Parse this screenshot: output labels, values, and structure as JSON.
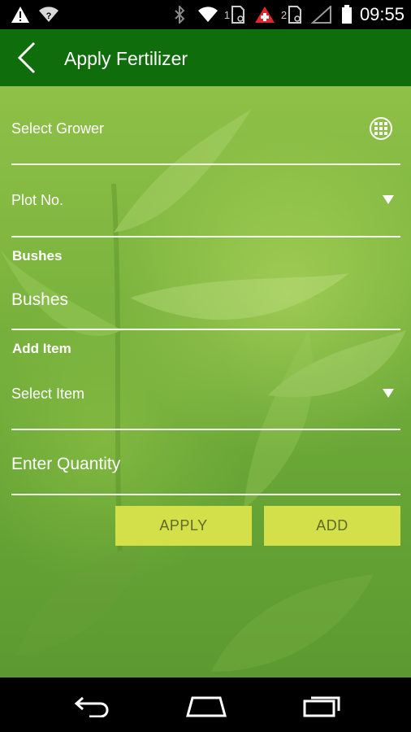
{
  "status_bar": {
    "time": "09:55",
    "sim1": "1",
    "sim2": "2",
    "icons": [
      "warning-icon",
      "wifi-question-icon",
      "bluetooth-icon",
      "wifi-icon",
      "sim1-icon",
      "swiss-flag-icon",
      "sim2-icon",
      "signal-icon",
      "battery-icon"
    ]
  },
  "app_bar": {
    "title": "Apply Fertilizer",
    "background": "#0f6d0c"
  },
  "form": {
    "grower_placeholder": "Select Grower",
    "plot_placeholder": "Plot No.",
    "bushes_label": "Bushes",
    "bushes_placeholder": "Bushes",
    "add_item_label": "Add Item",
    "item_placeholder": "Select Item",
    "quantity_placeholder": "Enter Quantity"
  },
  "buttons": {
    "apply": "APPLY",
    "add": "ADD",
    "color": "#d3e04a"
  },
  "nav_bar": {
    "items": [
      "back-nav-icon",
      "home-nav-icon",
      "recents-nav-icon"
    ]
  }
}
